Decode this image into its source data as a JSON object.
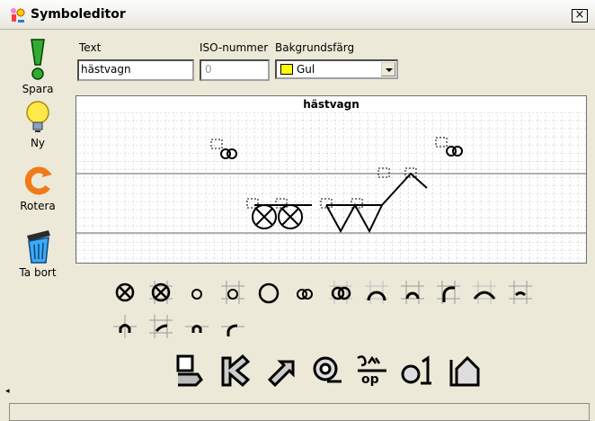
{
  "window": {
    "title": "Symboleditor",
    "close_label": "×"
  },
  "toolbar": {
    "items": [
      {
        "label": "Spara",
        "icon": "save-icon"
      },
      {
        "label": "Ny",
        "icon": "lightbulb-icon"
      },
      {
        "label": "Rotera",
        "icon": "rotate-icon"
      },
      {
        "label": "Ta bort",
        "icon": "trash-icon"
      }
    ]
  },
  "form": {
    "text_label": "Text",
    "text_value": "hästvagn",
    "iso_label": "ISO-nummer",
    "iso_value": "0",
    "bg_label": "Bakgrundsfärg",
    "bg_value": "Gul",
    "bg_color": "#ffff00"
  },
  "canvas": {
    "title": "hästvagn"
  },
  "palette": {
    "icons": [
      "circle-x-icon",
      "circle-x-grid-icon",
      "small-circle-icon",
      "small-circle-grid-icon",
      "large-circle-icon",
      "double-ring-icon",
      "double-ring-large-icon",
      "arch-icon",
      "arch-grid-icon",
      "corner-arc-icon",
      "wide-arch-icon",
      "arch-small-grid-icon",
      "cross-arch-icon",
      "grid-arc-icon",
      "small-arch-icon",
      "corner-arc-small-icon"
    ]
  },
  "actions": {
    "icons": [
      "flip-down-icon",
      "flip-left-icon",
      "move-diagonal-icon",
      "wrap-icon",
      "top-bottom-icon",
      "zero-one-icon",
      "frame-icon"
    ]
  }
}
